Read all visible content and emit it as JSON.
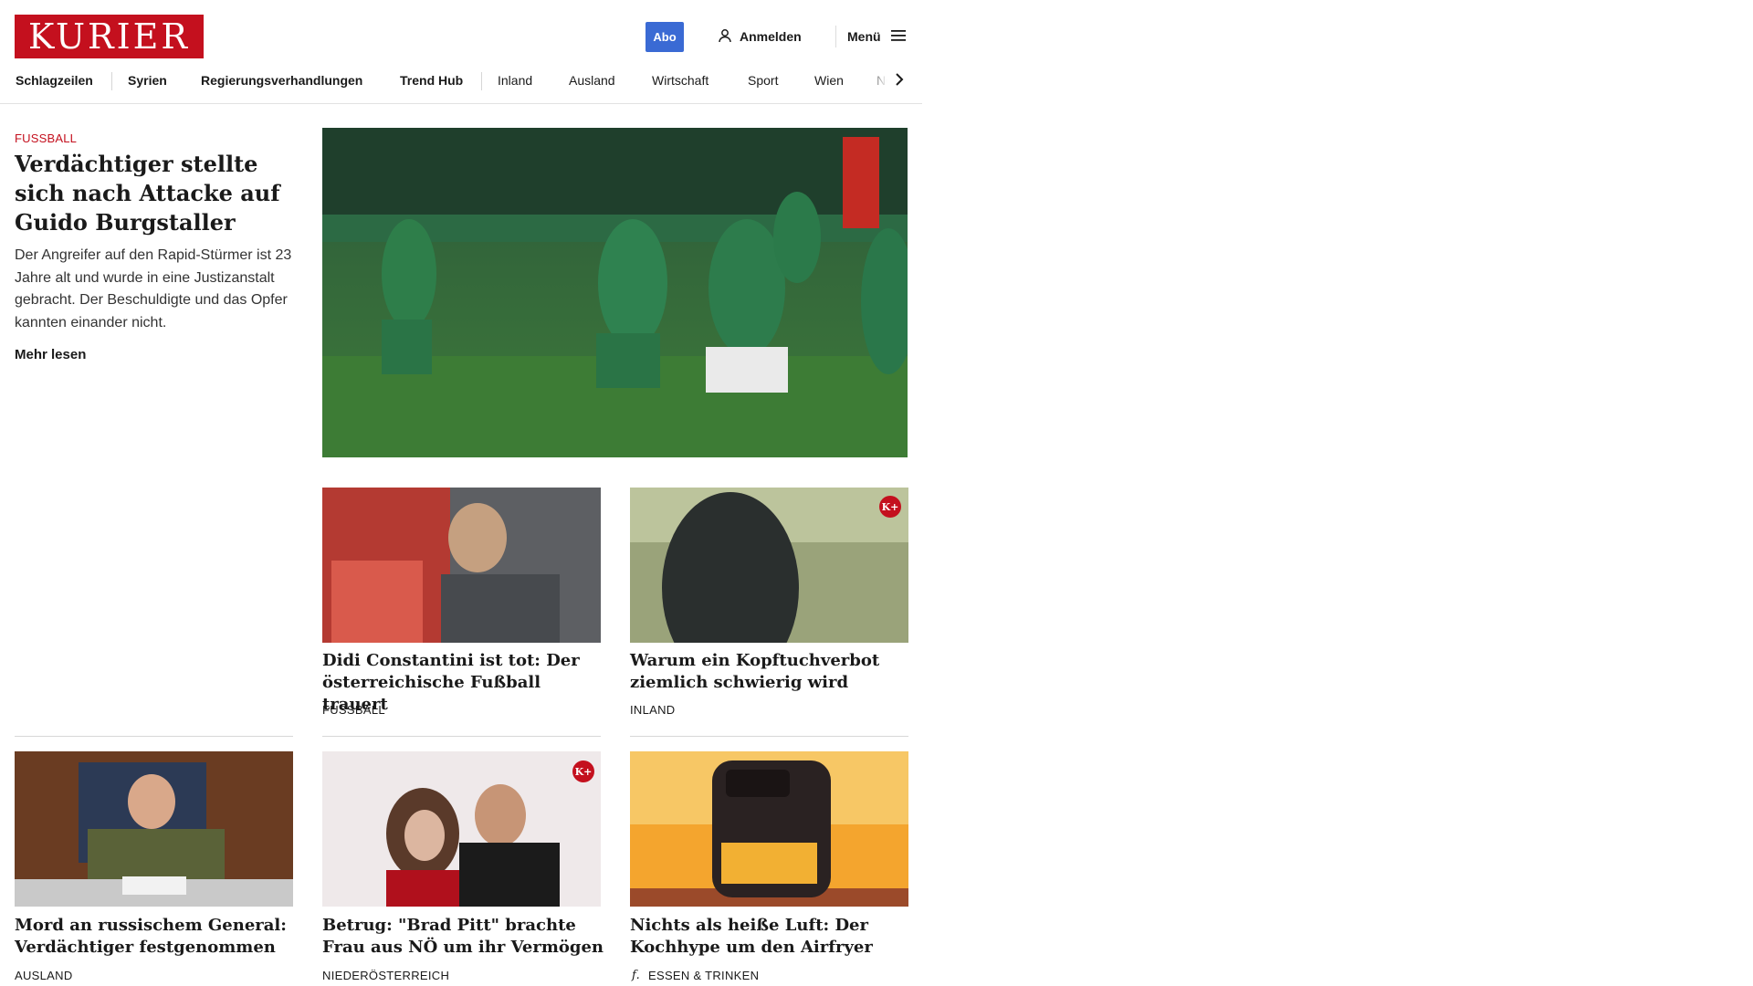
{
  "header": {
    "logo_text": "KURIER",
    "abo_label": "Abo",
    "login_label": "Anmelden",
    "menu_label": "Menü",
    "brand_color": "#c4101e",
    "accent_color": "#3a6ad4"
  },
  "nav": {
    "items": [
      {
        "label": "Schlagzeilen"
      },
      {
        "label": "Syrien"
      },
      {
        "label": "Regierungsverhandlungen"
      },
      {
        "label": "Trend Hub"
      },
      {
        "label": "Inland"
      },
      {
        "label": "Ausland"
      },
      {
        "label": "Wirtschaft"
      },
      {
        "label": "Sport"
      },
      {
        "label": "Wien"
      },
      {
        "label": "NÖ"
      }
    ],
    "next_icon": "chevron-right-icon"
  },
  "lead": {
    "kicker": "FUSSBALL",
    "title": "Verdächtiger stellte sich nach Attacke auf Guido Burgstaller",
    "teaser": "Der Angreifer auf den Rapid-Stürmer ist 23 Jahre alt und wurde in eine Justizanstalt gebracht. Der Beschuldigte und das Opfer kannten einander nicht.",
    "more_label": "Mehr lesen"
  },
  "cards": [
    {
      "title": "Didi Constantini ist tot: Der öster­reichische Fußball trauert",
      "kicker": "FUSSBALL"
    },
    {
      "title": "Warum ein Kopftuchverbot ziem­lich schwierig wird",
      "kicker": "INLAND",
      "plus_badge": "K+"
    },
    {
      "title": "Mord an russischem General: Ver­dächtiger festgenommen",
      "kicker": "AUSLAND"
    },
    {
      "title": "Betrug: \"Brad Pitt\" brachte Frau aus NÖ um ihr Vermögen",
      "kicker": "NIEDERÖSTERREICH",
      "plus_badge": "K+"
    },
    {
      "title": "Nichts als heiße Luft: Der Koch­hype um den Airfryer",
      "kicker": "ESSEN & TRINKEN",
      "kicker_icon": "f."
    }
  ]
}
